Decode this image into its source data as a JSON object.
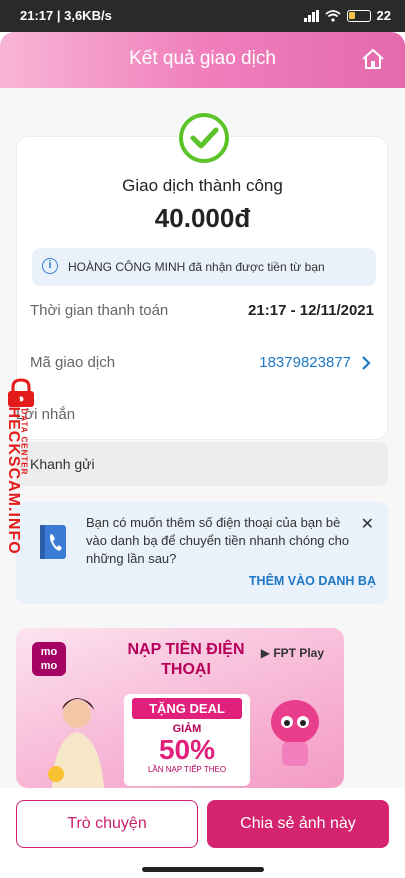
{
  "status_bar": {
    "time_network": "21:17 | 3,6KB/s",
    "battery": "22"
  },
  "header": {
    "title": "Kết quả giao dịch"
  },
  "receipt": {
    "status": "Giao dịch thành công",
    "amount": "40.000đ",
    "notice": "HOÀNG CÔNG MINH đã nhận được tiền từ bạn",
    "payment_time_label": "Thời gian thanh toán",
    "payment_time_value": "21:17 - 12/11/2021",
    "transaction_id_label": "Mã giao dịch",
    "transaction_id_value": "18379823877"
  },
  "message": {
    "label": "Lời nhắn",
    "text": "Khanh gửi"
  },
  "contact_prompt": {
    "text": "Bạn có muốn thêm số điện thoại của bạn bè vào danh bạ để chuyển tiền nhanh chóng cho những lần sau?",
    "action": "THÊM VÀO DANH BẠ"
  },
  "banner": {
    "brand": "mo mo",
    "headline": "NẠP TIỀN ĐIỆN THOẠI",
    "partner": "FPT Play",
    "deal": "TẶNG DEAL",
    "discount_label": "GIẢM",
    "discount_value": "50%",
    "discount_note": "LẦN NẠP TIẾP THEO"
  },
  "watermark": {
    "main": "CHECKSCAM.INFO",
    "sub": "DATA CENTER"
  },
  "footer": {
    "chat_button": "Trò chuyện",
    "share_button": "Chia sẻ ảnh này"
  },
  "colors": {
    "brand_pink": "#d4246f",
    "link_blue": "#1f78c4",
    "success_green": "#5cc428"
  }
}
